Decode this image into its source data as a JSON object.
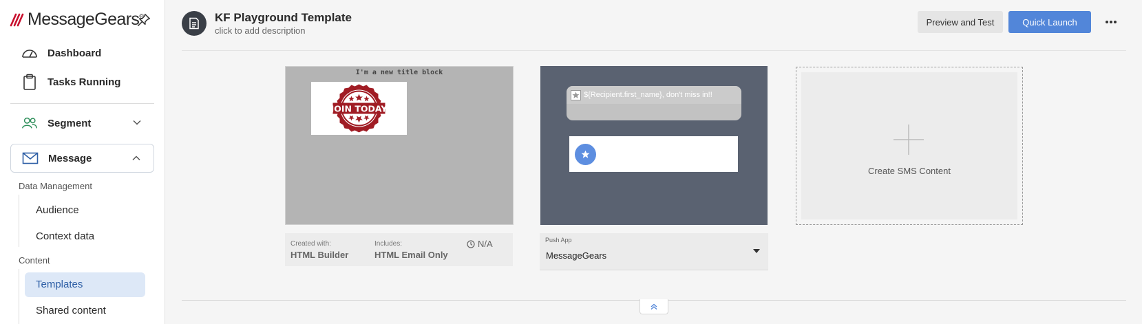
{
  "brand": {
    "name": "MessageGears",
    "reg": "®"
  },
  "sidebar": {
    "dashboard": "Dashboard",
    "tasks": "Tasks Running",
    "segment": "Segment",
    "message": "Message",
    "data_management": {
      "heading": "Data Management",
      "items": [
        "Audience",
        "Context data"
      ]
    },
    "content": {
      "heading": "Content",
      "items": [
        "Templates",
        "Shared content"
      ]
    }
  },
  "header": {
    "title": "KF Playground Template",
    "description": "click to add description",
    "preview_button": "Preview and Test",
    "launch_button": "Quick Launch"
  },
  "email_card": {
    "preview_title": "I'm a new title block",
    "badge_text": "JOIN TODAY",
    "created_label": "Created with:",
    "created_value": "HTML Builder",
    "includes_label": "Includes:",
    "includes_value": "HTML Email Only",
    "status": "N/A"
  },
  "push_card": {
    "notification_text": "${Recipient.first_name}, don't miss in!!",
    "select_label": "Push App",
    "select_value": "MessageGears"
  },
  "sms_card": {
    "label": "Create SMS Content"
  },
  "colors": {
    "accent": "#5286d9",
    "sidebar_active_bg": "#dde8f7",
    "push_bg": "#5a6271",
    "brand_red": "#c8102e"
  }
}
